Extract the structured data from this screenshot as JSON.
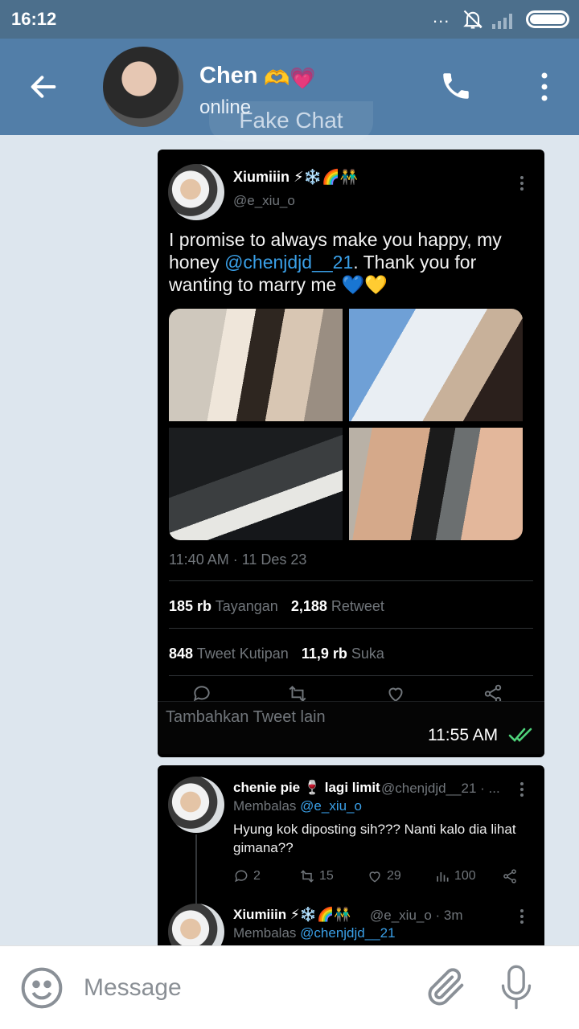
{
  "status_bar": {
    "time": "16:12",
    "dots": "..."
  },
  "header": {
    "name": "Chen",
    "name_emojis": "🫶💗",
    "status": "online",
    "watermark": "Fake Chat"
  },
  "tweet": {
    "author_name": "Xiumiiin ⚡❄️🌈👬",
    "author_handle": "@e_xiu_o",
    "text_before": "I promise to always make you happy, my honey ",
    "mention": "@chenjdjd__21",
    "text_after": ". Thank you for wanting to marry me 💙💛",
    "timestamp": "11:40 AM · 11 Des 23",
    "views_count": "185 rb",
    "views_label": "Tayangan",
    "retweets_count": "2,188",
    "retweets_label": "Retweet",
    "quotes_count": "848",
    "quotes_label": "Tweet Kutipan",
    "likes_count": "11,9 rb",
    "likes_label": "Suka",
    "add_tweet": "Tambahkan Tweet lain",
    "msg_time": "11:55 AM"
  },
  "reply": {
    "author_name": "chenie pie 🍷 lagi limit",
    "author_handle": "@chenjdjd__21 · ...",
    "replying_to_label": "Membalas",
    "replying_to_handle": "@e_xiu_o",
    "text": "Hyung kok diposting sih??? Nanti kalo dia lihat gimana??",
    "replies": "2",
    "retweets": "15",
    "likes": "29",
    "views": "100"
  },
  "reply2": {
    "author_name": "Xiumiiin ⚡❄️🌈👬",
    "author_handle": "@e_xiu_o · 3m",
    "replying_to_label": "Membalas",
    "replying_to_handle": "@chenjdjd__21"
  },
  "composer": {
    "placeholder": "Message"
  },
  "colors": {
    "header": "#527ea8",
    "status_bar": "#4c6f8c",
    "chat_bg": "#dde6ee",
    "link": "#3aa0e8",
    "read_checks": "#4fd27a"
  }
}
